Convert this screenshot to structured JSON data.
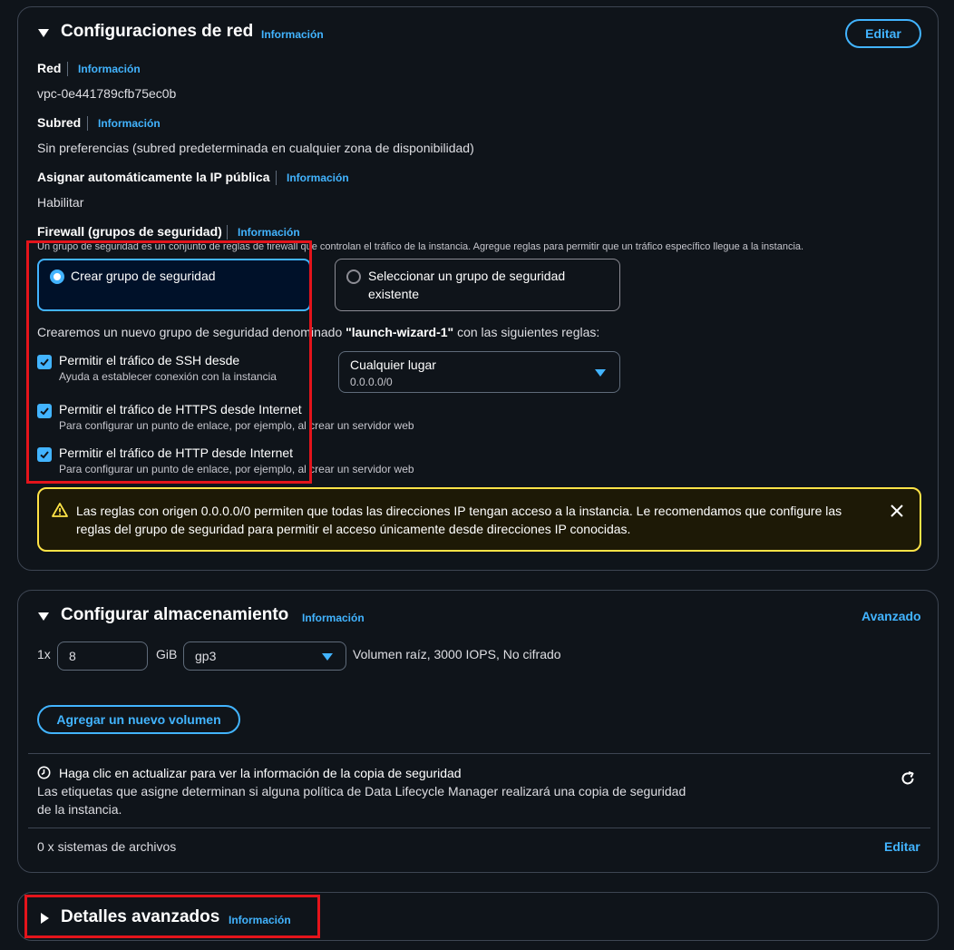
{
  "network": {
    "title": "Configuraciones de red",
    "info": "Información",
    "edit_label": "Editar",
    "vpc_label": "Red",
    "vpc_info": "Información",
    "vpc_value": "vpc-0e441789cfb75ec0b",
    "subnet_label": "Subred",
    "subnet_info": "Información",
    "subnet_value": "Sin preferencias (subred predeterminada en cualquier zona de disponibilidad)",
    "public_ip_label": "Asignar automáticamente la IP pública",
    "public_ip_info": "Información",
    "public_ip_value": "Habilitar",
    "firewall_label": "Firewall (grupos de seguridad)",
    "firewall_info": "Información",
    "firewall_desc": "Un grupo de seguridad es un conjunto de reglas de firewall que controlan el tráfico de la instancia. Agregue reglas para permitir que un tráfico específico llegue a la instancia.",
    "option_create": "Crear grupo de seguridad",
    "option_select_line1": "Seleccionar un grupo de seguridad",
    "option_select_line2": "existente",
    "create_note_prefix": "Crearemos un nuevo grupo de seguridad denominado ",
    "create_note_name": "\"launch-wizard-1\"",
    "create_note_suffix": " con las siguientes reglas:",
    "rules": [
      {
        "label": "Permitir el tráfico de SSH desde",
        "desc": "Ayuda a establecer conexión con la instancia",
        "checked": true
      },
      {
        "label": "Permitir el tráfico de HTTPS desde Internet",
        "desc": "Para configurar un punto de enlace, por ejemplo, al crear un servidor web",
        "checked": true
      },
      {
        "label": "Permitir el tráfico de HTTP desde Internet",
        "desc": "Para configurar un punto de enlace, por ejemplo, al crear un servidor web",
        "checked": true
      }
    ],
    "ssh_source": {
      "selected": "Cualquier lugar",
      "sub": "0.0.0.0/0"
    },
    "warning_line1": "Las reglas con origen 0.0.0.0/0 permiten que todas las direcciones IP tengan acceso a la instancia. Le recomendamos que configure las",
    "warning_line2": "reglas del grupo de seguridad para permitir el acceso únicamente desde direcciones IP conocidas."
  },
  "storage": {
    "title": "Configurar almacenamiento",
    "info": "Información",
    "advanced_label": "Avanzado",
    "count_prefix": "1x",
    "size_value": "8",
    "size_unit": "GiB",
    "volume_type": "gp3",
    "volume_summary": "Volumen raíz,  3000 IOPS,  No cifrado",
    "add_volume_label": "Agregar un nuevo volumen",
    "backup_title": "Haga clic en actualizar para ver la información de la copia de seguridad",
    "backup_desc_line1": "Las etiquetas que asigne determinan si alguna política de Data Lifecycle Manager realizará una copia de seguridad",
    "backup_desc_line2": "de la instancia.",
    "filesystems_label": "0 x sistemas de archivos",
    "filesystems_edit": "Editar"
  },
  "advanced": {
    "title": "Detalles avanzados",
    "info": "Información"
  },
  "colors": {
    "accent": "#42b4ff",
    "warning": "#ffe347",
    "highlight": "#e4141b",
    "background": "#0f141a"
  }
}
